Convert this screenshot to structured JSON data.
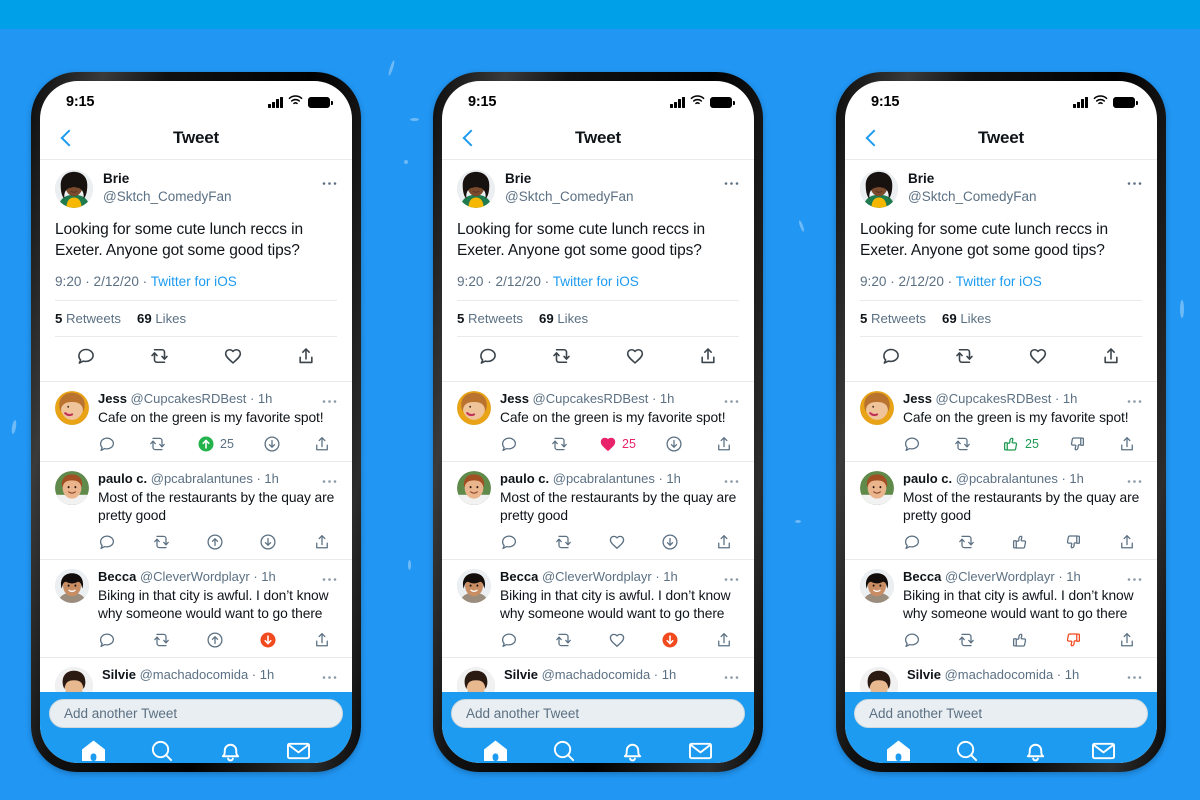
{
  "background": {
    "color_main": "#2196f3",
    "color_top_strip": "#00a0e9"
  },
  "accent": {
    "twitter_blue": "#1d9bf0",
    "green": "#23b24b",
    "orange_red": "#f04a1e",
    "pink": "#e8226b",
    "green_outline": "#1d9b52",
    "gray_text": "#5b7083"
  },
  "status_bar": {
    "time": "9:15",
    "signal_icon": "cellular-signal-icon",
    "wifi_icon": "wifi-icon",
    "battery_icon": "battery-icon"
  },
  "nav": {
    "back_icon": "back-chevron-icon",
    "title": "Tweet"
  },
  "main_tweet": {
    "avatar_alt": "brie-avatar",
    "name": "Brie",
    "handle": "@Sktch_ComedyFan",
    "more_icon": "more-options-icon",
    "text": "Looking for some cute lunch reccs in Exeter. Anyone got some good tips?",
    "time": "9:20",
    "date": "2/12/20",
    "separator": "·",
    "source": "Twitter for iOS",
    "retweets_count": "5",
    "retweets_label": "Retweets",
    "likes_count": "69",
    "likes_label": "Likes",
    "actions": [
      {
        "name": "reply-icon",
        "label": "Reply"
      },
      {
        "name": "retweet-icon",
        "label": "Retweet"
      },
      {
        "name": "heart-icon",
        "label": "Like"
      },
      {
        "name": "share-icon",
        "label": "Share"
      }
    ]
  },
  "replies": [
    {
      "avatar_alt": "jess-avatar",
      "name": "Jess",
      "handle": "@CupcakesRDBest",
      "time": "1h",
      "separator": "·",
      "text": "Cafe on the green is my favorite spot!",
      "count": "25",
      "more_icon": "more-options-icon"
    },
    {
      "avatar_alt": "paulo-avatar",
      "name": "paulo c.",
      "handle": "@pcabralantunes",
      "time": "1h",
      "separator": "·",
      "text": "Most of the restaurants by the quay are pretty good",
      "count": "",
      "more_icon": "more-options-icon"
    },
    {
      "avatar_alt": "becca-avatar",
      "name": "Becca",
      "handle": "@CleverWordplayr",
      "time": "1h",
      "separator": "·",
      "text": "Biking in that city is awful. I don’t know why someone would want to go there",
      "count": "",
      "more_icon": "more-options-icon"
    }
  ],
  "reply_partial": {
    "avatar_alt": "silvie-avatar",
    "name": "Silvie",
    "handle": "@machadocomida",
    "time": "1h",
    "separator": "·",
    "more_icon": "more-options-icon"
  },
  "composer": {
    "placeholder": "Add another Tweet"
  },
  "tabbar": {
    "items": [
      {
        "name": "home-icon",
        "label": "Home"
      },
      {
        "name": "search-icon",
        "label": "Search"
      },
      {
        "name": "notifications-bell-icon",
        "label": "Notifications"
      },
      {
        "name": "messages-envelope-icon",
        "label": "Messages"
      }
    ]
  },
  "variants": [
    {
      "id": "phone-1",
      "reaction_style": "arrows",
      "upvote_icon": "upvote-arrow-circle-icon",
      "downvote_icon": "downvote-arrow-circle-icon",
      "active_up_color": "#23b24b",
      "active_down_color": "#f04a1e",
      "count_color": "#5b7083"
    },
    {
      "id": "phone-2",
      "reaction_style": "heart",
      "upvote_icon": "heart-icon",
      "downvote_icon": "downvote-arrow-circle-icon",
      "active_up_color": "#e8226b",
      "active_down_color": "#f04a1e",
      "count_color": "#e8226b"
    },
    {
      "id": "phone-3",
      "reaction_style": "thumbs",
      "upvote_icon": "thumbs-up-icon",
      "downvote_icon": "thumbs-down-icon",
      "active_up_color": "#1d9b52",
      "active_down_color": "#f04a1e",
      "count_color": "#1d9b52"
    }
  ]
}
